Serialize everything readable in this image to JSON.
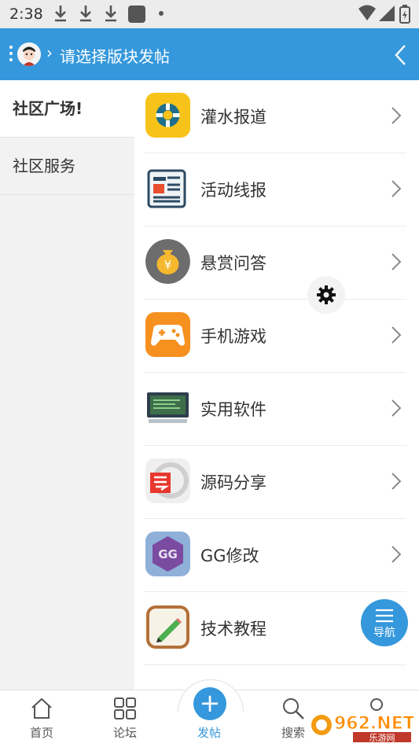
{
  "status_bar": {
    "time": "2:38"
  },
  "header": {
    "title": "请选择版块发帖",
    "separator": "›"
  },
  "sidebar": {
    "items": [
      {
        "label": "社区广场!",
        "active": true
      },
      {
        "label": "社区服务",
        "active": false
      }
    ]
  },
  "forums": [
    {
      "label": "灌水报道",
      "icon": "lifebuoy-icon"
    },
    {
      "label": "活动线报",
      "icon": "newspaper-icon"
    },
    {
      "label": "悬赏问答",
      "icon": "money-bag-icon"
    },
    {
      "label": "手机游戏",
      "icon": "gamepad-icon"
    },
    {
      "label": "实用软件",
      "icon": "monitor-icon"
    },
    {
      "label": "源码分享",
      "icon": "source-code-icon"
    },
    {
      "label": "GG修改",
      "icon": "gg-icon"
    },
    {
      "label": "技术教程",
      "icon": "notepad-pencil-icon"
    }
  ],
  "nav_float": {
    "label": "导航"
  },
  "bottom_nav": {
    "home": "首页",
    "forum": "论坛",
    "post": "发帖",
    "search": "搜索"
  },
  "watermark": {
    "text": "962.NET",
    "sub": "乐游网"
  },
  "colors": {
    "accent": "#3598dc",
    "sidebar_bg": "#f2f2f2"
  }
}
